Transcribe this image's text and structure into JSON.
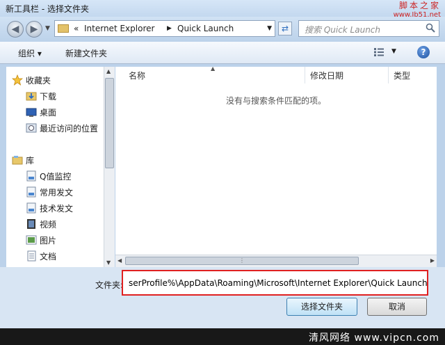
{
  "window": {
    "title": "新工具栏 - 选择文件夹",
    "watermark_top_line1": "脚本之家",
    "watermark_top_line2": "www.Jb51.net",
    "watermark_bottom": "清风网络 www.vipcn.com"
  },
  "address_bar": {
    "overflow_glyph": "«",
    "segments": [
      "Internet Explorer",
      "Quick Launch"
    ]
  },
  "search": {
    "placeholder": "搜索 Quick Launch"
  },
  "toolbar": {
    "organize_label": "组织 ▾",
    "new_folder_label": "新建文件夹"
  },
  "nav_pane": {
    "favorites": {
      "label": "收藏夹",
      "icon": "star-icon"
    },
    "favorite_items": [
      {
        "label": "下载",
        "icon": "download-folder-icon"
      },
      {
        "label": "桌面",
        "icon": "desktop-icon"
      },
      {
        "label": "最近访问的位置",
        "icon": "recent-places-icon"
      }
    ],
    "libraries": {
      "label": "库",
      "icon": "library-icon"
    },
    "library_items": [
      {
        "label": "Q值监控",
        "icon": "library-item-icon"
      },
      {
        "label": "常用发文",
        "icon": "library-item-icon"
      },
      {
        "label": "技术发文",
        "icon": "library-item-icon"
      },
      {
        "label": "视频",
        "icon": "video-icon"
      },
      {
        "label": "图片",
        "icon": "pictures-icon"
      },
      {
        "label": "文档",
        "icon": "documents-icon"
      }
    ]
  },
  "file_list": {
    "columns": [
      "名称",
      "修改日期",
      "类型"
    ],
    "empty_message": "没有与搜索条件匹配的项。"
  },
  "footer": {
    "folder_label": "文件夹:",
    "folder_value": "serProfile%\\AppData\\Roaming\\Microsoft\\Internet Explorer\\Quick Launch",
    "select_button": "选择文件夹",
    "cancel_button": "取消"
  },
  "colors": {
    "highlight_border": "#e02020",
    "window_bg": "#bcd2ea"
  }
}
